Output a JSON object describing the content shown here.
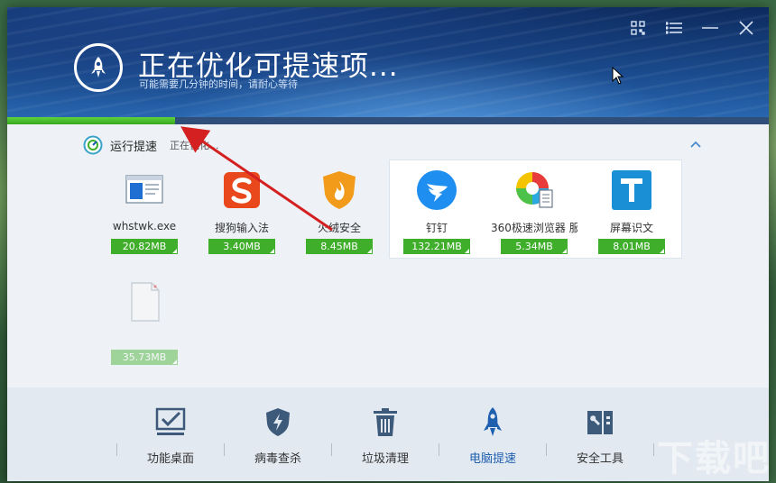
{
  "header": {
    "title": "正在优化可提速项...",
    "subtitle": "可能需要几分钟的时间，请耐心等待",
    "progress_percent": 22
  },
  "section": {
    "title": "运行提速",
    "status": "正在优化..."
  },
  "apps": [
    {
      "name": "whstwk.exe",
      "size": "20.82MB",
      "icon": "app-window-icon",
      "faded": false
    },
    {
      "name": "搜狗输入法",
      "size": "3.40MB",
      "icon": "sogou-icon",
      "faded": false
    },
    {
      "name": "火绒安全",
      "size": "8.45MB",
      "icon": "huorong-icon",
      "faded": false
    },
    {
      "name": "钉钉",
      "size": "132.21MB",
      "icon": "dingtalk-icon",
      "faded": false
    },
    {
      "name": "360极速浏览器 服...",
      "size": "5.34MB",
      "icon": "360-browser-icon",
      "faded": false
    },
    {
      "name": "屏幕识文",
      "size": "8.01MB",
      "icon": "screen-ocr-icon",
      "faded": false
    },
    {
      "name": "",
      "size": "35.73MB",
      "icon": "blank-file-icon",
      "faded": true
    }
  ],
  "nav": [
    {
      "label": "功能桌面",
      "icon": "desktop-check-icon"
    },
    {
      "label": "病毒查杀",
      "icon": "shield-bolt-icon"
    },
    {
      "label": "垃圾清理",
      "icon": "trash-icon"
    },
    {
      "label": "电脑提速",
      "icon": "rocket-icon",
      "active": true
    },
    {
      "label": "安全工具",
      "icon": "toolbox-icon"
    }
  ],
  "watermark": "下载吧",
  "colors": {
    "accent_green": "#3fae2a",
    "nav_active": "#1f5fb0",
    "annotation_red": "#d42020"
  }
}
